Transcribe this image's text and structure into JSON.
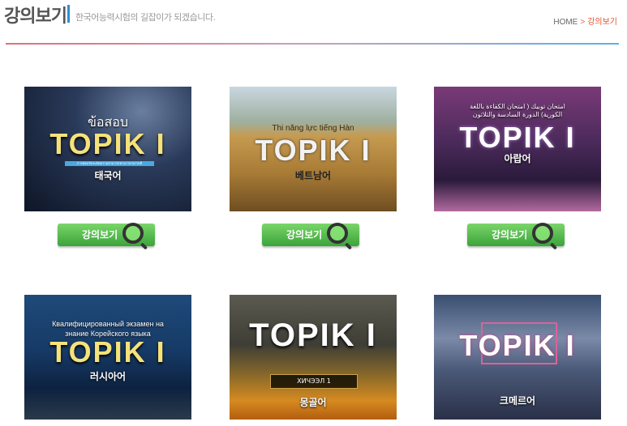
{
  "header": {
    "title": "강의보기",
    "subtitle": "한국어능력시험의 길잡이가 되겠습니다.",
    "breadcrumb_home": "HOME",
    "breadcrumb_sep": ">",
    "breadcrumb_current": "강의보기"
  },
  "button_label": "강의보기",
  "cards": [
    {
      "top_text": "ข้อสอบ",
      "logo": "TOPIK I",
      "mid_text": "การสอบวัดระดับความสามารถทางภาษาเกาหลี",
      "lang": "태국어"
    },
    {
      "top_text": "Thi năng lực tiếng Hàn",
      "logo": "TOPIK I",
      "mid_text": "",
      "lang": "베트남어"
    },
    {
      "top_text": "امتحان توبيك ( امتحان الكفاءة باللغة الكورية) الدورة السادسة والثلاثون",
      "logo": "TOPIK I",
      "mid_text": "",
      "lang": "아랍어"
    },
    {
      "top_text": "Квалифицированный экзамен на знание Корейского языка",
      "logo": "TOPIK I",
      "mid_text": "",
      "lang": "러시아어"
    },
    {
      "top_text": "",
      "logo": "TOPIK I",
      "mid_text": "ХИЧЭЭЛ 1",
      "lang": "몽골어"
    },
    {
      "top_text": "",
      "logo": "TOPIK I",
      "mid_text": "",
      "lang": "크메르어"
    }
  ]
}
